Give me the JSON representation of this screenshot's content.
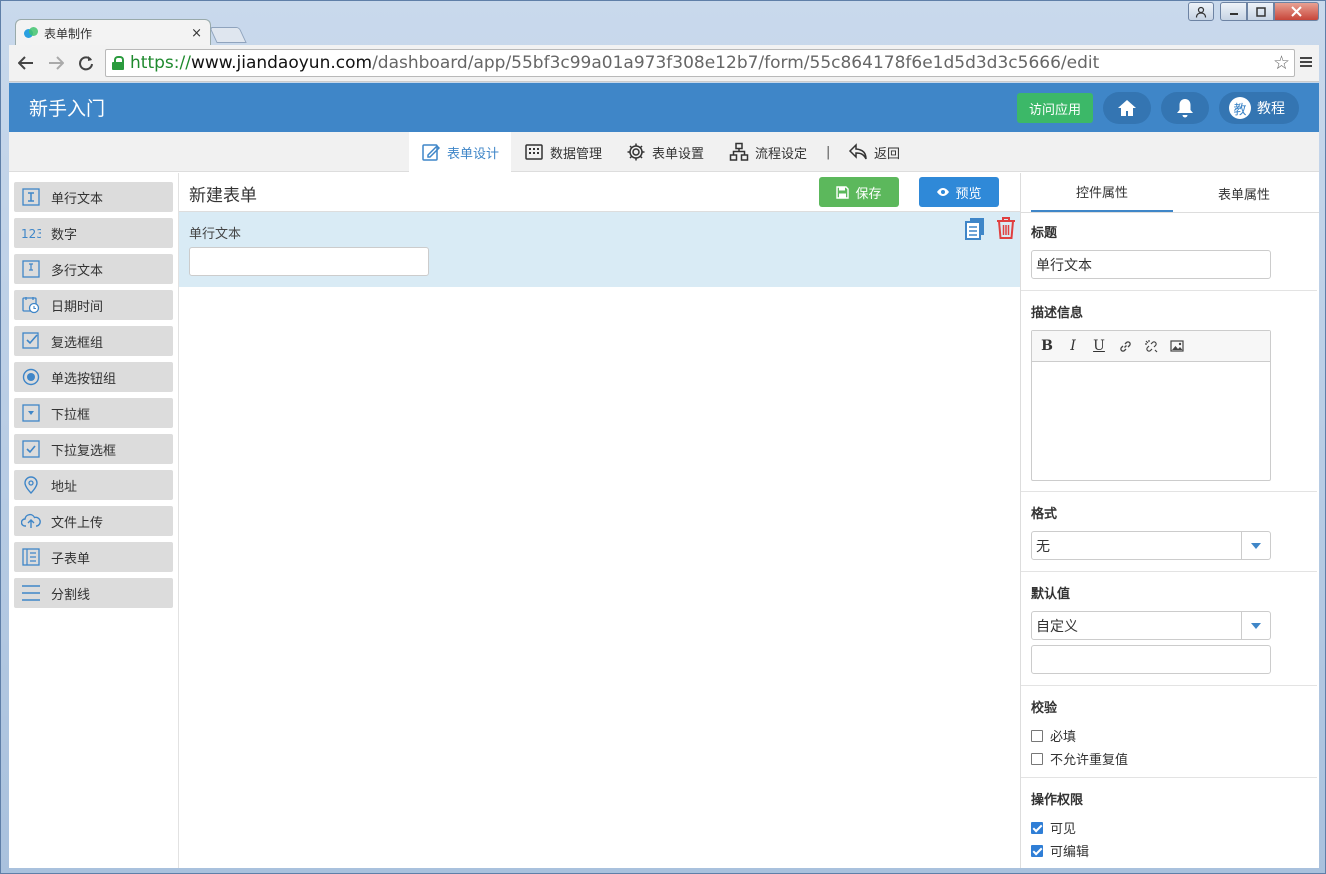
{
  "browser": {
    "tab_title": "表单制作",
    "tab_close": "×",
    "url_scheme": "https://",
    "url_host": "www.jiandaoyun.com",
    "url_path": "/dashboard/app/55bf3c99a01a973f308e12b7/form/55c864178f6e1d5d3d3c5666/edit"
  },
  "header": {
    "title": "新手入门",
    "visit_button": "访问应用",
    "tutorial_avatar": "教",
    "tutorial_label": "教程"
  },
  "subnav": {
    "form_design": "表单设计",
    "data_manage": "数据管理",
    "form_settings": "表单设置",
    "flow_settings": "流程设定",
    "separator": "|",
    "back": "返回"
  },
  "components": [
    {
      "label": "单行文本",
      "icon": "single-line-text-icon"
    },
    {
      "label": "数字",
      "icon": "number-icon"
    },
    {
      "label": "多行文本",
      "icon": "multi-line-text-icon"
    },
    {
      "label": "日期时间",
      "icon": "datetime-icon"
    },
    {
      "label": "复选框组",
      "icon": "checkbox-group-icon"
    },
    {
      "label": "单选按钮组",
      "icon": "radio-group-icon"
    },
    {
      "label": "下拉框",
      "icon": "dropdown-icon"
    },
    {
      "label": "下拉复选框",
      "icon": "dropdown-checkbox-icon"
    },
    {
      "label": "地址",
      "icon": "location-icon"
    },
    {
      "label": "文件上传",
      "icon": "upload-icon"
    },
    {
      "label": "子表单",
      "icon": "subform-icon"
    },
    {
      "label": "分割线",
      "icon": "divider-icon"
    }
  ],
  "canvas": {
    "form_title": "新建表单",
    "save_button": "保存",
    "preview_button": "预览",
    "field_label": "单行文本",
    "field_value": ""
  },
  "properties": {
    "tab_control": "控件属性",
    "tab_form": "表单属性",
    "title_label": "标题",
    "title_value": "单行文本",
    "desc_label": "描述信息",
    "format_label": "格式",
    "format_value": "无",
    "default_label": "默认值",
    "default_value": "自定义",
    "validation_label": "校验",
    "required_label": "必填",
    "no_duplicate_label": "不允许重复值",
    "permission_label": "操作权限",
    "visible_label": "可见",
    "editable_label": "可编辑",
    "required_checked": false,
    "no_duplicate_checked": false,
    "visible_checked": true,
    "editable_checked": true
  },
  "colors": {
    "header_blue": "#3f86c8",
    "save_green": "#5cb85c",
    "preview_blue": "#2f89d8",
    "visit_green": "#3cb868",
    "field_highlight": "#d9ebf5",
    "delete_red": "#e04040"
  }
}
